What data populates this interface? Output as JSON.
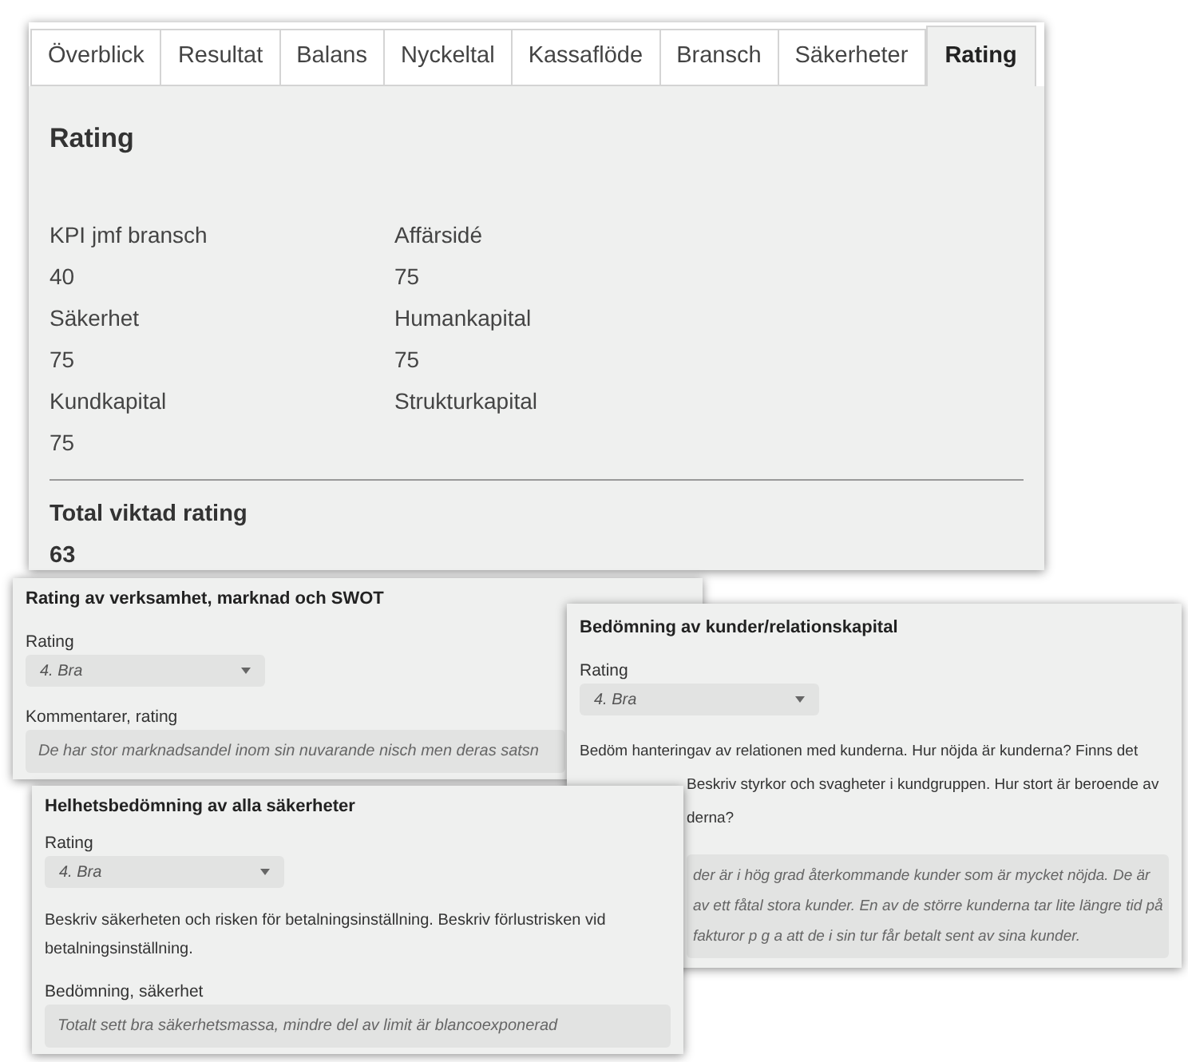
{
  "tabs": [
    {
      "label": "Överblick",
      "selected": false
    },
    {
      "label": "Resultat",
      "selected": false
    },
    {
      "label": "Balans",
      "selected": false
    },
    {
      "label": "Nyckeltal",
      "selected": false
    },
    {
      "label": "Kassaflöde",
      "selected": false
    },
    {
      "label": "Bransch",
      "selected": false
    },
    {
      "label": "Säkerheter",
      "selected": false
    },
    {
      "label": "Rating",
      "selected": true
    }
  ],
  "rating": {
    "title": "Rating",
    "items": [
      {
        "label": "KPI jmf bransch",
        "value": "40"
      },
      {
        "label": "Affärsidé",
        "value": "75"
      },
      {
        "label": "Säkerhet",
        "value": "75"
      },
      {
        "label": "Humankapital",
        "value": "75"
      },
      {
        "label": "Kundkapital",
        "value": "75"
      },
      {
        "label": "Strukturkapital"
      }
    ],
    "total_label": "Total viktad rating",
    "total_value": "63"
  },
  "cards": [
    {
      "title": "Rating av verksamhet, marknad och SWOT",
      "fields": [
        {
          "kind": "select",
          "label": "Rating",
          "value": "4. Bra"
        },
        {
          "kind": "comment",
          "label": "Kommentarer, rating",
          "text": "De har stor marknadsandel inom sin nuvarande nisch men deras satsn"
        }
      ]
    },
    {
      "title": "Bedömning av kunder/relationskapital",
      "fields": [
        {
          "kind": "select",
          "label": "Rating",
          "value": "4. Bra"
        },
        {
          "kind": "description",
          "lines": [
            {
              "text": "Bedöm hanteringav av relationen med kunderna. Hur nöjda är kunderna? Finns det",
              "covered": false
            },
            {
              "text": "Beskriv styrkor och svagheter i kundgruppen. Hur stort är beroende av",
              "covered": true
            },
            {
              "text": "derna?",
              "covered": true
            }
          ]
        },
        {
          "kind": "comment",
          "lines": [
            {
              "text": "der är i hög grad återkommande kunder som är mycket nöjda. De är",
              "covered": true
            },
            {
              "text": "av ett fåtal stora kunder. En av de större kunderna tar lite längre tid på",
              "covered": true
            },
            {
              "text": "fakturor p g a att de i sin tur får betalt sent av sina kunder.",
              "covered": true
            }
          ]
        }
      ]
    },
    {
      "title": "Helhetsbedömning av alla säkerheter",
      "fields": [
        {
          "kind": "select",
          "label": "Rating",
          "value": "4. Bra"
        },
        {
          "kind": "description",
          "text": "Beskriv säkerheten och risken för betalningsinställning. Beskriv förlustrisken vid betalningsinställning."
        },
        {
          "kind": "comment",
          "label": "Bedömning, säkerhet",
          "text": "Totalt sett bra säkerhetsmassa, mindre del av limit är blancoexponerad"
        }
      ]
    }
  ]
}
